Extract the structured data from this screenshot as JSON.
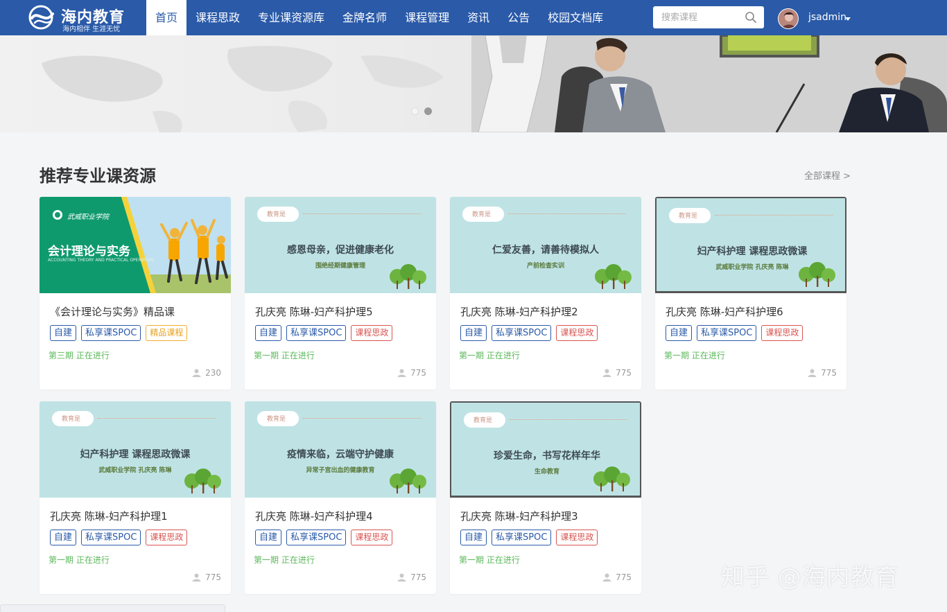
{
  "header": {
    "brand_title": "海内教育",
    "brand_slogan": "海内相伴 生涯无忧",
    "nav": [
      "首页",
      "课程思政",
      "专业课资源库",
      "金牌名师",
      "课程管理",
      "资讯",
      "公告",
      "校园文档库"
    ],
    "active_index": 0,
    "search_placeholder": "搜索课程",
    "username": "jsadmin"
  },
  "section": {
    "title": "推荐专业课资源",
    "all_link": "全部课程 >"
  },
  "cards": [
    {
      "thumb_type": "green",
      "thumb_school": "武威职业学院",
      "thumb_title": "会计理论与实务",
      "thumb_sub": "ACCOUNTING THEORY AND PRACTICAL OPERATION",
      "title": "《会计理论与实务》精品课",
      "tags": [
        {
          "text": "自建",
          "style": "blue"
        },
        {
          "text": "私享课SPOC",
          "style": "blue"
        },
        {
          "text": "精品课程",
          "style": "orange"
        }
      ],
      "status": "第三期 正在进行",
      "count": "230"
    },
    {
      "thumb_type": "teal",
      "thumb_label": "教育是",
      "thumb_title": "感恩母亲，促进健康老化",
      "thumb_sub": "围绝经期健康管理",
      "title": "孔庆亮 陈琳-妇产科护理5",
      "tags": [
        {
          "text": "自建",
          "style": "blue"
        },
        {
          "text": "私享课SPOC",
          "style": "blue"
        },
        {
          "text": "课程思政",
          "style": "red"
        }
      ],
      "status": "第一期 正在进行",
      "count": "775"
    },
    {
      "thumb_type": "teal",
      "thumb_label": "教育是",
      "thumb_title": "仁爱友善，请善待模拟人",
      "thumb_sub": "产前检查实训",
      "title": "孔庆亮 陈琳-妇产科护理2",
      "tags": [
        {
          "text": "自建",
          "style": "blue"
        },
        {
          "text": "私享课SPOC",
          "style": "blue"
        },
        {
          "text": "课程思政",
          "style": "red"
        }
      ],
      "status": "第一期 正在进行",
      "count": "775"
    },
    {
      "thumb_type": "teal-framed",
      "thumb_label": "教育是",
      "thumb_title": "妇产科护理 课程思政微课",
      "thumb_sub": "武威职业学院 孔庆亮 陈琳",
      "title": "孔庆亮 陈琳-妇产科护理6",
      "tags": [
        {
          "text": "自建",
          "style": "blue"
        },
        {
          "text": "私享课SPOC",
          "style": "blue"
        },
        {
          "text": "课程思政",
          "style": "red"
        }
      ],
      "status": "第一期 正在进行",
      "count": "775"
    },
    {
      "thumb_type": "teal",
      "thumb_label": "教育是",
      "thumb_title": "妇产科护理 课程思政微课",
      "thumb_sub": "武威职业学院 孔庆亮 陈琳",
      "title": "孔庆亮 陈琳-妇产科护理1",
      "tags": [
        {
          "text": "自建",
          "style": "blue"
        },
        {
          "text": "私享课SPOC",
          "style": "blue"
        },
        {
          "text": "课程思政",
          "style": "red"
        }
      ],
      "status": "第一期 正在进行",
      "count": "775"
    },
    {
      "thumb_type": "teal",
      "thumb_label": "教育是",
      "thumb_title": "疫情来临，云端守护健康",
      "thumb_sub": "异常子宫出血的健康教育",
      "title": "孔庆亮 陈琳-妇产科护理4",
      "tags": [
        {
          "text": "自建",
          "style": "blue"
        },
        {
          "text": "私享课SPOC",
          "style": "blue"
        },
        {
          "text": "课程思政",
          "style": "red"
        }
      ],
      "status": "第一期 正在进行",
      "count": "775"
    },
    {
      "thumb_type": "teal-framed",
      "thumb_label": "教育是",
      "thumb_title": "珍爱生命，书写花样年华",
      "thumb_sub": "生命教育",
      "title": "孔庆亮 陈琳-妇产科护理3",
      "tags": [
        {
          "text": "自建",
          "style": "blue"
        },
        {
          "text": "私享课SPOC",
          "style": "blue"
        },
        {
          "text": "课程思政",
          "style": "red"
        }
      ],
      "status": "第一期 正在进行",
      "count": "775"
    }
  ],
  "watermark": "知乎 @海内教育",
  "colors": {
    "primary": "#2a5aa8",
    "tag_red": "#d9534f",
    "tag_orange": "#f0ad2c",
    "status_green": "#5cb85c"
  }
}
